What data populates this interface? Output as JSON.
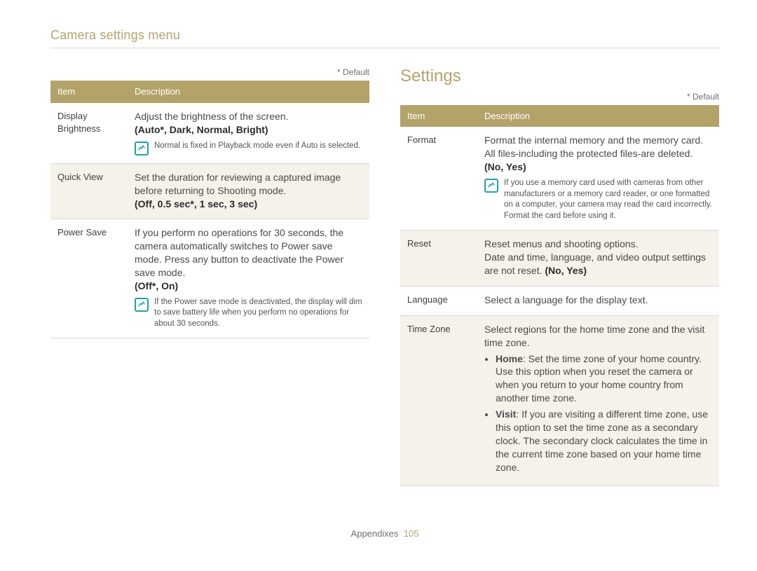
{
  "breadcrumb": "Camera settings menu",
  "section_title": "Settings",
  "default_note": "* Default",
  "footer": {
    "label": "Appendixes",
    "page": "105"
  },
  "table_header": {
    "item": "Item",
    "description": "Description"
  },
  "left_rows": [
    {
      "item": "Display Brightness",
      "desc": "Adjust the brightness of the screen.",
      "opts": "(Auto*, Dark, Normal, Bright)",
      "note": "Normal is fixed in Playback mode even if Auto is selected."
    },
    {
      "item": "Quick View",
      "desc": "Set the duration for reviewing a captured image before returning to Shooting mode.",
      "opts": "(Off, 0.5 sec*, 1 sec, 3 sec)"
    },
    {
      "item": "Power Save",
      "desc": "If you perform no operations for 30 seconds, the camera automatically switches to Power save mode. Press any button to deactivate the Power save mode.",
      "opts": "(Off*, On)",
      "note": "If the Power save mode is deactivated, the display will dim to save battery life when you perform no operations for about 30 seconds."
    }
  ],
  "right_rows": [
    {
      "item": "Format",
      "desc": "Format the internal memory and the memory card. All files-including the protected files-are deleted.",
      "opts": "(No, Yes)",
      "note": "If you use a memory card used with cameras from other manufacturers or a memory card reader, or one formatted on a computer, your camera may read the card incorrectly. Format the card before using it."
    },
    {
      "item": "Reset",
      "desc_pre": "Reset menus and shooting options.\nDate and time, language, and video output settings are not reset. ",
      "opts_inline": "(No, Yes)"
    },
    {
      "item": "Language",
      "desc": "Select a language for the display text."
    },
    {
      "item": "Time Zone",
      "desc": "Select regions for the home time zone and the visit time zone.",
      "bullets": [
        {
          "lead": "Home",
          "text": ": Set the time zone of your home country. Use this option when you reset the camera or when you return to your home country from another time zone."
        },
        {
          "lead": "Visit",
          "text": ": If you are visiting a different time zone, use this option to set the time zone as a secondary clock. The secondary clock calculates the time in the current time zone based on your home time zone."
        }
      ]
    }
  ]
}
